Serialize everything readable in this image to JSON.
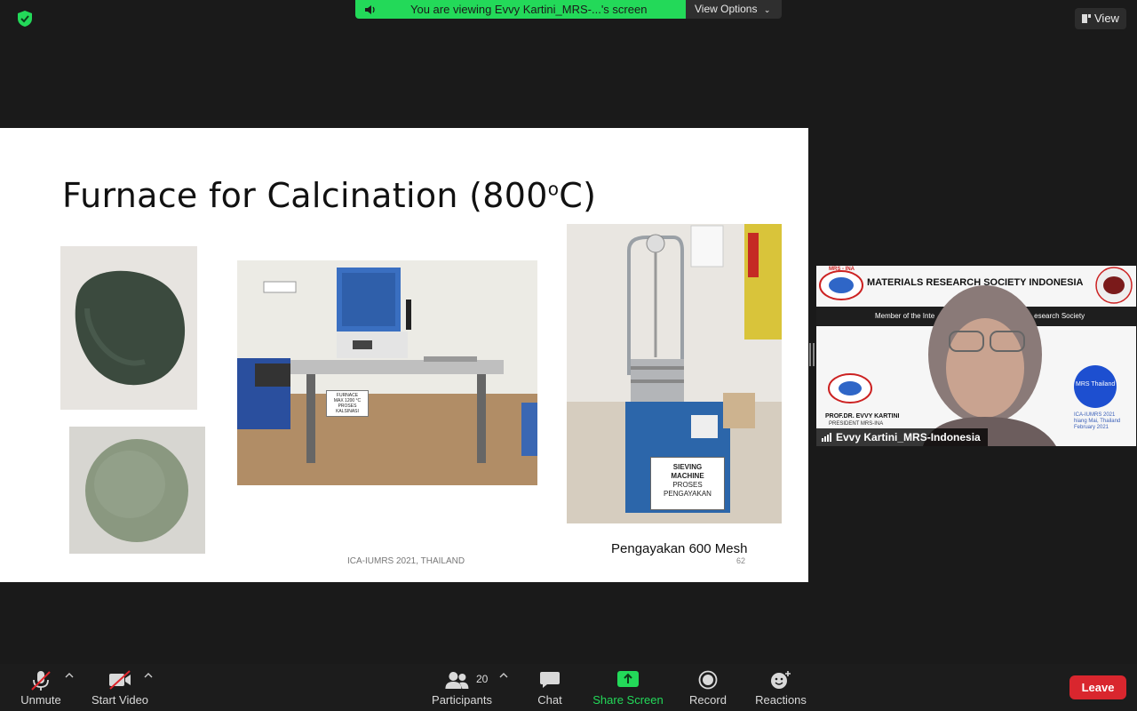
{
  "share_banner": {
    "text": "You are viewing Evvy Kartini_MRS-...'s screen",
    "options_label": "View Options"
  },
  "view_button": {
    "label": "View"
  },
  "slide": {
    "title": "Furnace for Calcination (800",
    "title_sup": "o",
    "title_end": "C)",
    "furnace_label": [
      "FURNACE",
      "MAX 1200 °C",
      "PROSES",
      "KALSINASI"
    ],
    "sieving_label": [
      "SIEVING",
      "MACHINE",
      "PROSES",
      "PENGAYAKAN"
    ],
    "mesh_caption": "Pengayakan 600 Mesh",
    "footer": "ICA-IUMRS 2021, THAILAND",
    "page_number": "62"
  },
  "video": {
    "participant_name": "Evvy Kartini_MRS-Indonesia",
    "bg_header": "MATERIALS RESEARCH SOCIETY INDONESIA",
    "bg_subheader": "Member of the Inte",
    "bg_subheader_end": "esearch Society",
    "bg_logo_text": "MRS - INA",
    "bg_president": "PROF.DR. EVVY KARTINI",
    "bg_president_role": "PRESIDENT MRS-INA",
    "bg_thailand": "MRS Thailand",
    "bg_event": "ICA-IUMRS 2021",
    "bg_event2": "hiang Mai, Thailand",
    "bg_event3": "February 2021"
  },
  "toolbar": {
    "unmute": "Unmute",
    "start_video": "Start Video",
    "participants": "Participants",
    "participant_count": "20",
    "chat": "Chat",
    "share_screen": "Share Screen",
    "record": "Record",
    "reactions": "Reactions",
    "leave": "Leave"
  },
  "colors": {
    "share_green": "#23d959",
    "leave_red": "#d9262e",
    "toolbar_bg": "#1c1c1c"
  }
}
